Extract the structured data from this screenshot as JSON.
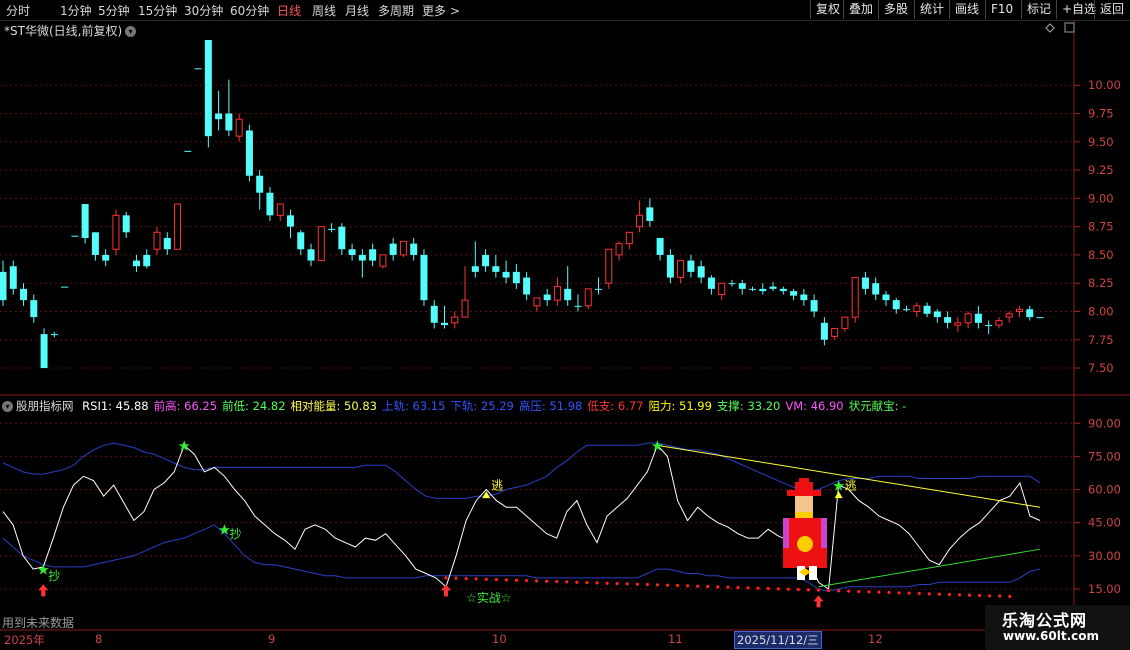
{
  "toolbar": {
    "timeframes": [
      "分时",
      "1分钟",
      "5分钟",
      "15分钟",
      "30分钟",
      "60分钟",
      "日线",
      "周线",
      "月线",
      "多周期",
      "更多"
    ],
    "more_chevron": ">",
    "active": "日线",
    "right_buttons": [
      "复权",
      "叠加",
      "多股",
      "统计",
      "画线",
      "F10",
      "+自选",
      "返回"
    ],
    "mark": "标记"
  },
  "main": {
    "title": "*ST华微(日线,前复权)",
    "y_labels": [
      "10.00",
      "9.75",
      "9.50",
      "9.25",
      "9.00",
      "8.75",
      "8.50",
      "8.25",
      "8.00",
      "7.75",
      "7.50"
    ]
  },
  "indicator": {
    "name": "股朋指标网",
    "items": [
      {
        "label": "RSI1: ",
        "value": "45.88",
        "color": "#ffffff"
      },
      {
        "label": "前高: ",
        "value": "66.25",
        "color": "#ff55ff"
      },
      {
        "label": "前低: ",
        "value": "24.82",
        "color": "#55ff55"
      },
      {
        "label": "相对能量: ",
        "value": "50.83",
        "color": "#ffff55"
      },
      {
        "label": "上轨: ",
        "value": "63.15",
        "color": "#3355ff"
      },
      {
        "label": "下轨: ",
        "value": "25.29",
        "color": "#3355ff"
      },
      {
        "label": "高压: ",
        "value": "51.98",
        "color": "#3355ff"
      },
      {
        "label": "低支: ",
        "value": "6.77",
        "color": "#ff3333"
      },
      {
        "label": "阻力: ",
        "value": "51.99",
        "color": "#ffff00"
      },
      {
        "label": "支撑: ",
        "value": "33.20",
        "color": "#55ff55"
      },
      {
        "label": "VM: ",
        "value": "46.90",
        "color": "#ff55ff"
      },
      {
        "label": "状元献宝: ",
        "value": "-",
        "color": "#55ff55"
      }
    ],
    "y_labels": [
      "90.00",
      "75.00",
      "60.00",
      "45.00",
      "30.00",
      "15.00"
    ],
    "signals": {
      "chao": "抄",
      "tao": "逃",
      "shizhan": "☆实战☆"
    }
  },
  "footer": {
    "future_text": "用到未来数据",
    "x_labels": [
      "2025年",
      "8",
      "9",
      "10",
      "11",
      "12"
    ],
    "selected_date": "2025/11/12/三",
    "watermark1": "乐淘公式网",
    "watermark2": "www.60lt.com"
  },
  "chart_data": {
    "type": "candlestick",
    "title": "*ST华微(日线,前复权)",
    "ylim": [
      7.35,
      10.4
    ],
    "candles": [
      [
        8.35,
        8.45,
        8.1,
        8.05
      ],
      [
        8.4,
        8.45,
        8.2,
        8.15
      ],
      [
        8.2,
        8.25,
        8.1,
        8.05
      ],
      [
        8.1,
        8.15,
        7.95,
        7.9
      ],
      [
        7.8,
        7.85,
        7.5,
        7.5
      ],
      [
        7.8,
        7.82,
        7.8,
        7.77
      ],
      [
        8.22,
        8.22,
        8.22,
        8.22
      ],
      [
        8.67,
        8.67,
        8.67,
        8.67
      ],
      [
        8.95,
        8.95,
        8.65,
        8.6
      ],
      [
        8.7,
        8.7,
        8.5,
        8.45
      ],
      [
        8.5,
        8.55,
        8.45,
        8.4
      ],
      [
        8.55,
        8.9,
        8.85,
        8.5
      ],
      [
        8.85,
        8.88,
        8.7,
        8.65
      ],
      [
        8.45,
        8.5,
        8.4,
        8.35
      ],
      [
        8.5,
        8.55,
        8.4,
        8.38
      ],
      [
        8.55,
        8.75,
        8.7,
        8.5
      ],
      [
        8.65,
        8.7,
        8.55,
        8.5
      ],
      [
        8.55,
        8.95,
        8.95,
        8.55
      ],
      [
        9.42,
        9.42,
        9.42,
        9.42
      ],
      [
        10.15,
        10.15,
        10.15,
        10.15
      ],
      [
        10.4,
        10.4,
        9.55,
        9.45
      ],
      [
        9.75,
        9.95,
        9.7,
        9.6
      ],
      [
        9.75,
        10.05,
        9.6,
        9.55
      ],
      [
        9.55,
        9.75,
        9.7,
        9.5
      ],
      [
        9.6,
        9.65,
        9.2,
        9.15
      ],
      [
        9.2,
        9.25,
        9.05,
        8.9
      ],
      [
        9.05,
        9.1,
        8.85,
        8.8
      ],
      [
        8.85,
        8.9,
        8.95,
        8.8
      ],
      [
        8.85,
        8.9,
        8.75,
        8.65
      ],
      [
        8.7,
        8.72,
        8.55,
        8.5
      ],
      [
        8.55,
        8.6,
        8.45,
        8.4
      ],
      [
        8.45,
        8.75,
        8.75,
        8.45
      ],
      [
        8.73,
        8.78,
        8.73,
        8.7
      ],
      [
        8.75,
        8.78,
        8.55,
        8.5
      ],
      [
        8.55,
        8.6,
        8.5,
        8.45
      ],
      [
        8.5,
        8.55,
        8.45,
        8.3
      ],
      [
        8.55,
        8.6,
        8.45,
        8.4
      ],
      [
        8.4,
        8.5,
        8.5,
        8.38
      ],
      [
        8.6,
        8.65,
        8.5,
        8.45
      ],
      [
        8.5,
        8.62,
        8.62,
        8.48
      ],
      [
        8.6,
        8.65,
        8.5,
        8.45
      ],
      [
        8.5,
        8.55,
        8.1,
        8.05
      ],
      [
        8.05,
        8.1,
        7.9,
        7.85
      ],
      [
        7.9,
        8.05,
        7.88,
        7.85
      ],
      [
        7.9,
        8.0,
        7.95,
        7.85
      ],
      [
        7.95,
        8.4,
        8.1,
        7.95
      ],
      [
        8.4,
        8.62,
        8.35,
        8.3
      ],
      [
        8.5,
        8.55,
        8.4,
        8.35
      ],
      [
        8.4,
        8.5,
        8.35,
        8.3
      ],
      [
        8.35,
        8.45,
        8.3,
        8.25
      ],
      [
        8.35,
        8.42,
        8.25,
        8.2
      ],
      [
        8.3,
        8.35,
        8.15,
        8.1
      ],
      [
        8.05,
        8.12,
        8.12,
        8.0
      ],
      [
        8.15,
        8.2,
        8.1,
        8.05
      ],
      [
        8.1,
        8.3,
        8.22,
        8.05
      ],
      [
        8.2,
        8.4,
        8.1,
        8.05
      ],
      [
        8.05,
        8.15,
        8.05,
        8.0
      ],
      [
        8.05,
        8.2,
        8.2,
        8.02
      ],
      [
        8.2,
        8.3,
        8.2,
        8.15
      ],
      [
        8.25,
        8.55,
        8.55,
        8.2
      ],
      [
        8.5,
        8.62,
        8.6,
        8.45
      ],
      [
        8.6,
        8.7,
        8.7,
        8.55
      ],
      [
        8.75,
        8.98,
        8.85,
        8.7
      ],
      [
        8.92,
        9.0,
        8.8,
        8.75
      ],
      [
        8.65,
        8.65,
        8.5,
        8.45
      ],
      [
        8.5,
        8.55,
        8.3,
        8.25
      ],
      [
        8.3,
        8.45,
        8.45,
        8.25
      ],
      [
        8.45,
        8.5,
        8.35,
        8.3
      ],
      [
        8.4,
        8.45,
        8.3,
        8.25
      ],
      [
        8.3,
        8.32,
        8.2,
        8.15
      ],
      [
        8.15,
        8.25,
        8.25,
        8.1
      ],
      [
        8.25,
        8.28,
        8.25,
        8.22
      ],
      [
        8.25,
        8.28,
        8.2,
        8.15
      ],
      [
        8.2,
        8.22,
        8.2,
        8.18
      ],
      [
        8.2,
        8.25,
        8.18,
        8.15
      ],
      [
        8.22,
        8.26,
        8.2,
        8.18
      ],
      [
        8.2,
        8.22,
        8.18,
        8.15
      ],
      [
        8.18,
        8.2,
        8.14,
        8.1
      ],
      [
        8.15,
        8.2,
        8.1,
        8.05
      ],
      [
        8.1,
        8.15,
        8.0,
        7.95
      ],
      [
        7.9,
        7.95,
        7.75,
        7.7
      ],
      [
        7.78,
        7.85,
        7.85,
        7.75
      ],
      [
        7.85,
        7.95,
        7.95,
        7.82
      ],
      [
        7.95,
        8.3,
        8.3,
        7.9
      ],
      [
        8.3,
        8.35,
        8.2,
        8.15
      ],
      [
        8.25,
        8.3,
        8.15,
        8.1
      ],
      [
        8.15,
        8.18,
        8.1,
        8.05
      ],
      [
        8.1,
        8.12,
        8.02,
        7.98
      ],
      [
        8.02,
        8.05,
        8.02,
        8.0
      ],
      [
        8.0,
        8.08,
        8.05,
        7.95
      ],
      [
        8.05,
        8.08,
        7.98,
        7.95
      ],
      [
        8.0,
        8.02,
        7.95,
        7.9
      ],
      [
        7.95,
        8.0,
        7.9,
        7.85
      ],
      [
        7.88,
        7.95,
        7.9,
        7.82
      ],
      [
        7.9,
        8.0,
        7.98,
        7.85
      ],
      [
        7.98,
        8.05,
        7.9,
        7.85
      ],
      [
        7.88,
        7.92,
        7.88,
        7.8
      ],
      [
        7.88,
        7.95,
        7.92,
        7.85
      ],
      [
        7.95,
        8.0,
        7.98,
        7.9
      ],
      [
        8.0,
        8.05,
        8.02,
        7.95
      ],
      [
        8.02,
        8.05,
        7.95,
        7.92
      ],
      [
        7.95,
        7.95,
        7.95,
        7.95
      ]
    ],
    "indicator_ylim": [
      10,
      96
    ],
    "rsi": [
      50,
      44,
      30,
      24,
      25,
      38,
      52,
      62,
      66,
      64,
      57,
      62,
      54,
      46,
      50,
      60,
      63,
      68,
      80,
      76,
      68,
      70,
      66,
      60,
      55,
      48,
      44,
      40,
      37,
      33,
      42,
      44,
      42,
      38,
      36,
      34,
      38,
      37,
      40,
      35,
      30,
      24,
      22,
      20,
      16,
      30,
      46,
      55,
      60,
      55,
      52,
      52,
      48,
      44,
      40,
      38,
      50,
      55,
      44,
      36,
      48,
      52,
      56,
      62,
      68,
      80,
      75,
      55,
      46,
      52,
      48,
      45,
      43,
      40,
      38,
      38,
      42,
      39,
      37,
      35,
      30,
      18,
      15,
      62,
      60,
      55,
      52,
      48,
      46,
      44,
      40,
      34,
      28,
      26,
      33,
      38,
      42,
      45,
      50,
      55,
      57,
      63,
      48,
      46
    ],
    "upper_band": [
      72,
      70,
      68,
      67,
      67,
      68,
      69,
      71,
      75,
      78,
      80,
      81,
      80,
      79,
      77,
      76,
      74,
      72,
      70,
      69,
      69,
      70,
      70,
      70,
      70,
      70,
      70,
      70,
      70,
      70,
      70,
      70,
      70,
      70,
      70,
      70,
      71,
      71,
      71,
      68,
      64,
      60,
      57,
      56,
      56,
      56,
      56,
      57,
      57,
      58,
      60,
      61,
      62,
      64,
      66,
      70,
      73,
      77,
      80,
      80,
      80,
      80,
      80,
      80,
      81,
      81,
      80,
      79,
      78,
      78,
      77,
      76,
      74,
      72,
      70,
      68,
      66,
      64,
      62,
      60,
      58,
      60,
      62,
      64,
      65,
      65,
      65,
      66,
      66,
      66,
      66,
      65,
      65,
      65,
      65,
      65,
      65,
      66,
      66,
      66,
      66,
      66,
      66,
      63
    ],
    "lower_band": [
      38,
      34,
      30,
      28,
      26,
      25,
      25,
      25,
      25,
      26,
      27,
      28,
      29,
      30,
      32,
      34,
      36,
      37,
      38,
      40,
      42,
      44,
      40,
      35,
      30,
      27,
      26,
      26,
      25,
      24,
      23,
      22,
      21,
      21,
      20,
      20,
      20,
      20,
      20,
      20,
      20,
      20,
      21,
      21,
      21,
      21,
      21,
      21,
      21,
      21,
      21,
      21,
      21,
      20,
      20,
      20,
      20,
      20,
      20,
      20,
      20,
      20,
      20,
      20,
      22,
      24,
      24,
      23,
      22,
      22,
      21,
      21,
      20,
      20,
      20,
      20,
      20,
      20,
      20,
      20,
      18,
      15,
      14,
      15,
      16,
      16,
      16,
      16,
      16,
      16,
      16,
      17,
      17,
      18,
      18,
      18,
      18,
      18,
      18,
      18,
      18,
      20,
      23,
      24
    ]
  }
}
